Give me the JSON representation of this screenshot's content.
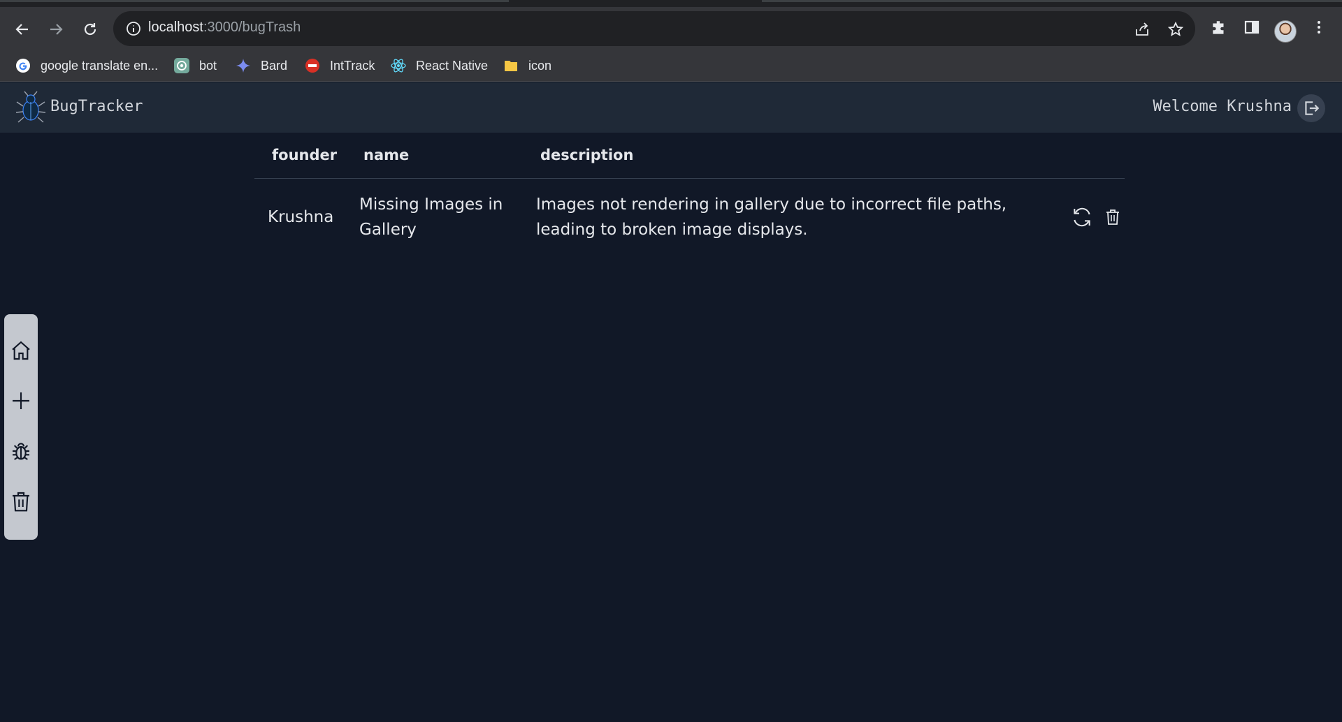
{
  "browser": {
    "url_host": "localhost",
    "url_path": ":3000/bugTrash",
    "bookmarks": [
      {
        "label": "google translate en...",
        "icon": "google-icon"
      },
      {
        "label": "bot",
        "icon": "openai-icon"
      },
      {
        "label": "Bard",
        "icon": "sparkle-icon"
      },
      {
        "label": "IntTrack",
        "icon": "tuf-icon"
      },
      {
        "label": "React Native",
        "icon": "react-icon"
      },
      {
        "label": "icon",
        "icon": "folder-icon"
      }
    ]
  },
  "app": {
    "brand": "BugTracker",
    "welcome": "Welcome Krushna",
    "table": {
      "headers": [
        "founder",
        "name",
        "description"
      ],
      "rows": [
        {
          "founder": "Krushna",
          "name": "Missing Images in Gallery",
          "description": "Images not rendering in gallery due to incorrect file paths, leading to broken image displays."
        }
      ]
    },
    "sidebar": [
      "home-icon",
      "plus-icon",
      "bug-icon",
      "trash-icon"
    ]
  },
  "colors": {
    "page_bg": "#111827",
    "header_bg": "#1f2937",
    "sidebar_bg": "#c4c8cf",
    "text": "#e5e7eb"
  }
}
